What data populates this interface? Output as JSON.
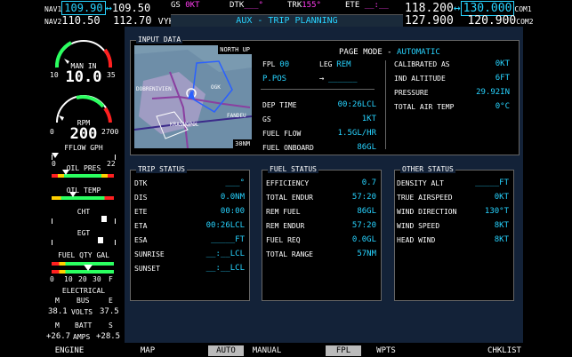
{
  "nav": {
    "nav1_label": "NAV1",
    "nav1_active": "109.90",
    "nav1_swap": "↔",
    "nav1_standby": "109.50",
    "nav2_label": "NAV2",
    "nav2_active": "110.50",
    "nav2_standby": "112.70",
    "nav2_ident": "VYK"
  },
  "com": {
    "com1_active": "118.200",
    "com1_swap": "↔",
    "com1_standby": "130.000",
    "com1_label": "COM1",
    "com2_active": "127.900",
    "com2_standby": "120.900",
    "com2_label": "COM2"
  },
  "status": {
    "gs_label": "GS",
    "gs_value": "0KT",
    "dtk_label": "DTK",
    "dtk_value": "___°",
    "trk_label": "TRK",
    "trk_value": "155°",
    "ete_label": "ETE",
    "ete_value": "__:__"
  },
  "page_title": "AUX - TRIP PLANNING",
  "eis": {
    "man_label": "MAN IN",
    "man_value": "10.0",
    "man_min": "10",
    "man_max": "35",
    "rpm_label": "RPM",
    "rpm_value": "200",
    "rpm_min": "0",
    "rpm_max": "2700",
    "fflow_label": "FFLOW GPH",
    "fflow_min": "0",
    "fflow_max": "22",
    "oil_pres_label": "OIL PRES",
    "oil_temp_label": "OIL TEMP",
    "cht_label": "CHT",
    "egt_label": "EGT",
    "fuel_qty_label": "FUEL QTY GAL",
    "fuel_ticks": [
      "0",
      "10",
      "20",
      "30",
      "F"
    ],
    "electrical_label": "ELECTRICAL",
    "bus_m": "M",
    "bus_label": "BUS",
    "bus_e": "E",
    "volts_m": "38.1",
    "volts_label": "VOLTS",
    "volts_e": "37.5",
    "batt_m": "M",
    "batt_label": "BATT",
    "batt_s": "S",
    "amps_m": "+26.7",
    "amps_label": "AMPS",
    "amps_s": "+28.5"
  },
  "input_data": {
    "title": "INPUT DATA",
    "map_orient": "NORTH UP",
    "map_range": "30NM",
    "map_labels": [
      "DOBRENIVIEN",
      "KRASNOPOL",
      "FANDEU",
      "OGK"
    ],
    "page_mode_label": "PAGE MODE -",
    "page_mode_value": "AUTOMATIC",
    "fpl_label": "FPL",
    "fpl_value": "00",
    "leg_label": "LEG",
    "leg_value": "REM",
    "ppos": "P.POS",
    "arrow": "→",
    "dest": "______",
    "dep_time_label": "DEP TIME",
    "dep_time_value": "00:26LCL",
    "gs_label": "GS",
    "gs_value": "1KT",
    "fuel_flow_label": "FUEL FLOW",
    "fuel_flow_value": "1.5GL/HR",
    "fuel_onboard_label": "FUEL ONBOARD",
    "fuel_onboard_value": "86GL",
    "calibrated_as_label": "CALIBRATED AS",
    "calibrated_as_value": "0KT",
    "ind_altitude_label": "IND ALTITUDE",
    "ind_altitude_value": "6FT",
    "pressure_label": "PRESSURE",
    "pressure_value": "29.92IN",
    "total_air_temp_label": "TOTAL AIR TEMP",
    "total_air_temp_value": "0°C"
  },
  "trip_status": {
    "title": "TRIP STATUS",
    "rows": [
      {
        "label": "DTK",
        "value": "___°"
      },
      {
        "label": "DIS",
        "value": "0.0NM"
      },
      {
        "label": "ETE",
        "value": "00:00"
      },
      {
        "label": "ETA",
        "value": "00:26LCL"
      },
      {
        "label": "ESA",
        "value": "_____FT"
      },
      {
        "label": "SUNRISE",
        "value": "__:__LCL"
      },
      {
        "label": "SUNSET",
        "value": "__:__LCL"
      }
    ]
  },
  "fuel_status": {
    "title": "FUEL STATUS",
    "rows": [
      {
        "label": "EFFICIENCY",
        "value": "0.7"
      },
      {
        "label": "TOTAL ENDUR",
        "value": "57:20"
      },
      {
        "label": "REM FUEL",
        "value": "86GL"
      },
      {
        "label": "REM ENDUR",
        "value": "57:20"
      },
      {
        "label": "FUEL REQ",
        "value": "0.0GL"
      },
      {
        "label": "TOTAL RANGE",
        "value": "57NM"
      }
    ]
  },
  "other_status": {
    "title": "OTHER STATUS",
    "rows": [
      {
        "label": "DENSITY ALT",
        "value": "_____FT"
      },
      {
        "label": "TRUE AIRSPEED",
        "value": "0KT"
      },
      {
        "label": "WIND DIRECTION",
        "value": "130°T"
      },
      {
        "label": "WIND SPEED",
        "value": "8KT"
      },
      {
        "label": "HEAD WIND",
        "value": "8KT"
      }
    ]
  },
  "softkeys": {
    "engine": "ENGINE",
    "map": "MAP",
    "auto": "AUTO",
    "manual": "MANUAL",
    "fpl": "FPL",
    "wpts": "WPTS",
    "chklist": "CHKLIST"
  },
  "colors": {
    "cyan": "#27d3ff",
    "magenta": "#ff3cf0",
    "green": "#2bff60",
    "bezel": "#132238"
  }
}
